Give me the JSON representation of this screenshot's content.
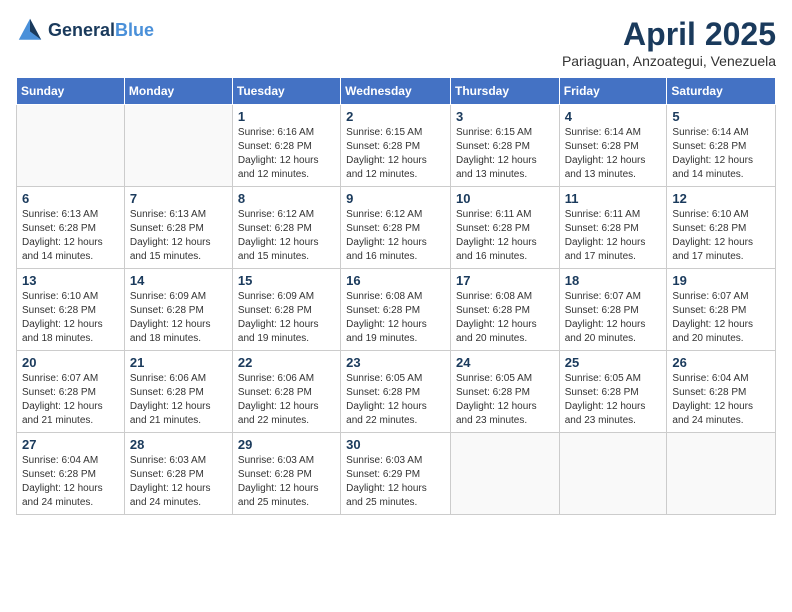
{
  "header": {
    "logo_general": "General",
    "logo_blue": "Blue",
    "month_title": "April 2025",
    "location": "Pariaguan, Anzoategui, Venezuela"
  },
  "calendar": {
    "days_of_week": [
      "Sunday",
      "Monday",
      "Tuesday",
      "Wednesday",
      "Thursday",
      "Friday",
      "Saturday"
    ],
    "weeks": [
      [
        {
          "day": "",
          "info": ""
        },
        {
          "day": "",
          "info": ""
        },
        {
          "day": "1",
          "info": "Sunrise: 6:16 AM\nSunset: 6:28 PM\nDaylight: 12 hours and 12 minutes."
        },
        {
          "day": "2",
          "info": "Sunrise: 6:15 AM\nSunset: 6:28 PM\nDaylight: 12 hours and 12 minutes."
        },
        {
          "day": "3",
          "info": "Sunrise: 6:15 AM\nSunset: 6:28 PM\nDaylight: 12 hours and 13 minutes."
        },
        {
          "day": "4",
          "info": "Sunrise: 6:14 AM\nSunset: 6:28 PM\nDaylight: 12 hours and 13 minutes."
        },
        {
          "day": "5",
          "info": "Sunrise: 6:14 AM\nSunset: 6:28 PM\nDaylight: 12 hours and 14 minutes."
        }
      ],
      [
        {
          "day": "6",
          "info": "Sunrise: 6:13 AM\nSunset: 6:28 PM\nDaylight: 12 hours and 14 minutes."
        },
        {
          "day": "7",
          "info": "Sunrise: 6:13 AM\nSunset: 6:28 PM\nDaylight: 12 hours and 15 minutes."
        },
        {
          "day": "8",
          "info": "Sunrise: 6:12 AM\nSunset: 6:28 PM\nDaylight: 12 hours and 15 minutes."
        },
        {
          "day": "9",
          "info": "Sunrise: 6:12 AM\nSunset: 6:28 PM\nDaylight: 12 hours and 16 minutes."
        },
        {
          "day": "10",
          "info": "Sunrise: 6:11 AM\nSunset: 6:28 PM\nDaylight: 12 hours and 16 minutes."
        },
        {
          "day": "11",
          "info": "Sunrise: 6:11 AM\nSunset: 6:28 PM\nDaylight: 12 hours and 17 minutes."
        },
        {
          "day": "12",
          "info": "Sunrise: 6:10 AM\nSunset: 6:28 PM\nDaylight: 12 hours and 17 minutes."
        }
      ],
      [
        {
          "day": "13",
          "info": "Sunrise: 6:10 AM\nSunset: 6:28 PM\nDaylight: 12 hours and 18 minutes."
        },
        {
          "day": "14",
          "info": "Sunrise: 6:09 AM\nSunset: 6:28 PM\nDaylight: 12 hours and 18 minutes."
        },
        {
          "day": "15",
          "info": "Sunrise: 6:09 AM\nSunset: 6:28 PM\nDaylight: 12 hours and 19 minutes."
        },
        {
          "day": "16",
          "info": "Sunrise: 6:08 AM\nSunset: 6:28 PM\nDaylight: 12 hours and 19 minutes."
        },
        {
          "day": "17",
          "info": "Sunrise: 6:08 AM\nSunset: 6:28 PM\nDaylight: 12 hours and 20 minutes."
        },
        {
          "day": "18",
          "info": "Sunrise: 6:07 AM\nSunset: 6:28 PM\nDaylight: 12 hours and 20 minutes."
        },
        {
          "day": "19",
          "info": "Sunrise: 6:07 AM\nSunset: 6:28 PM\nDaylight: 12 hours and 20 minutes."
        }
      ],
      [
        {
          "day": "20",
          "info": "Sunrise: 6:07 AM\nSunset: 6:28 PM\nDaylight: 12 hours and 21 minutes."
        },
        {
          "day": "21",
          "info": "Sunrise: 6:06 AM\nSunset: 6:28 PM\nDaylight: 12 hours and 21 minutes."
        },
        {
          "day": "22",
          "info": "Sunrise: 6:06 AM\nSunset: 6:28 PM\nDaylight: 12 hours and 22 minutes."
        },
        {
          "day": "23",
          "info": "Sunrise: 6:05 AM\nSunset: 6:28 PM\nDaylight: 12 hours and 22 minutes."
        },
        {
          "day": "24",
          "info": "Sunrise: 6:05 AM\nSunset: 6:28 PM\nDaylight: 12 hours and 23 minutes."
        },
        {
          "day": "25",
          "info": "Sunrise: 6:05 AM\nSunset: 6:28 PM\nDaylight: 12 hours and 23 minutes."
        },
        {
          "day": "26",
          "info": "Sunrise: 6:04 AM\nSunset: 6:28 PM\nDaylight: 12 hours and 24 minutes."
        }
      ],
      [
        {
          "day": "27",
          "info": "Sunrise: 6:04 AM\nSunset: 6:28 PM\nDaylight: 12 hours and 24 minutes."
        },
        {
          "day": "28",
          "info": "Sunrise: 6:03 AM\nSunset: 6:28 PM\nDaylight: 12 hours and 24 minutes."
        },
        {
          "day": "29",
          "info": "Sunrise: 6:03 AM\nSunset: 6:28 PM\nDaylight: 12 hours and 25 minutes."
        },
        {
          "day": "30",
          "info": "Sunrise: 6:03 AM\nSunset: 6:29 PM\nDaylight: 12 hours and 25 minutes."
        },
        {
          "day": "",
          "info": ""
        },
        {
          "day": "",
          "info": ""
        },
        {
          "day": "",
          "info": ""
        }
      ]
    ]
  }
}
